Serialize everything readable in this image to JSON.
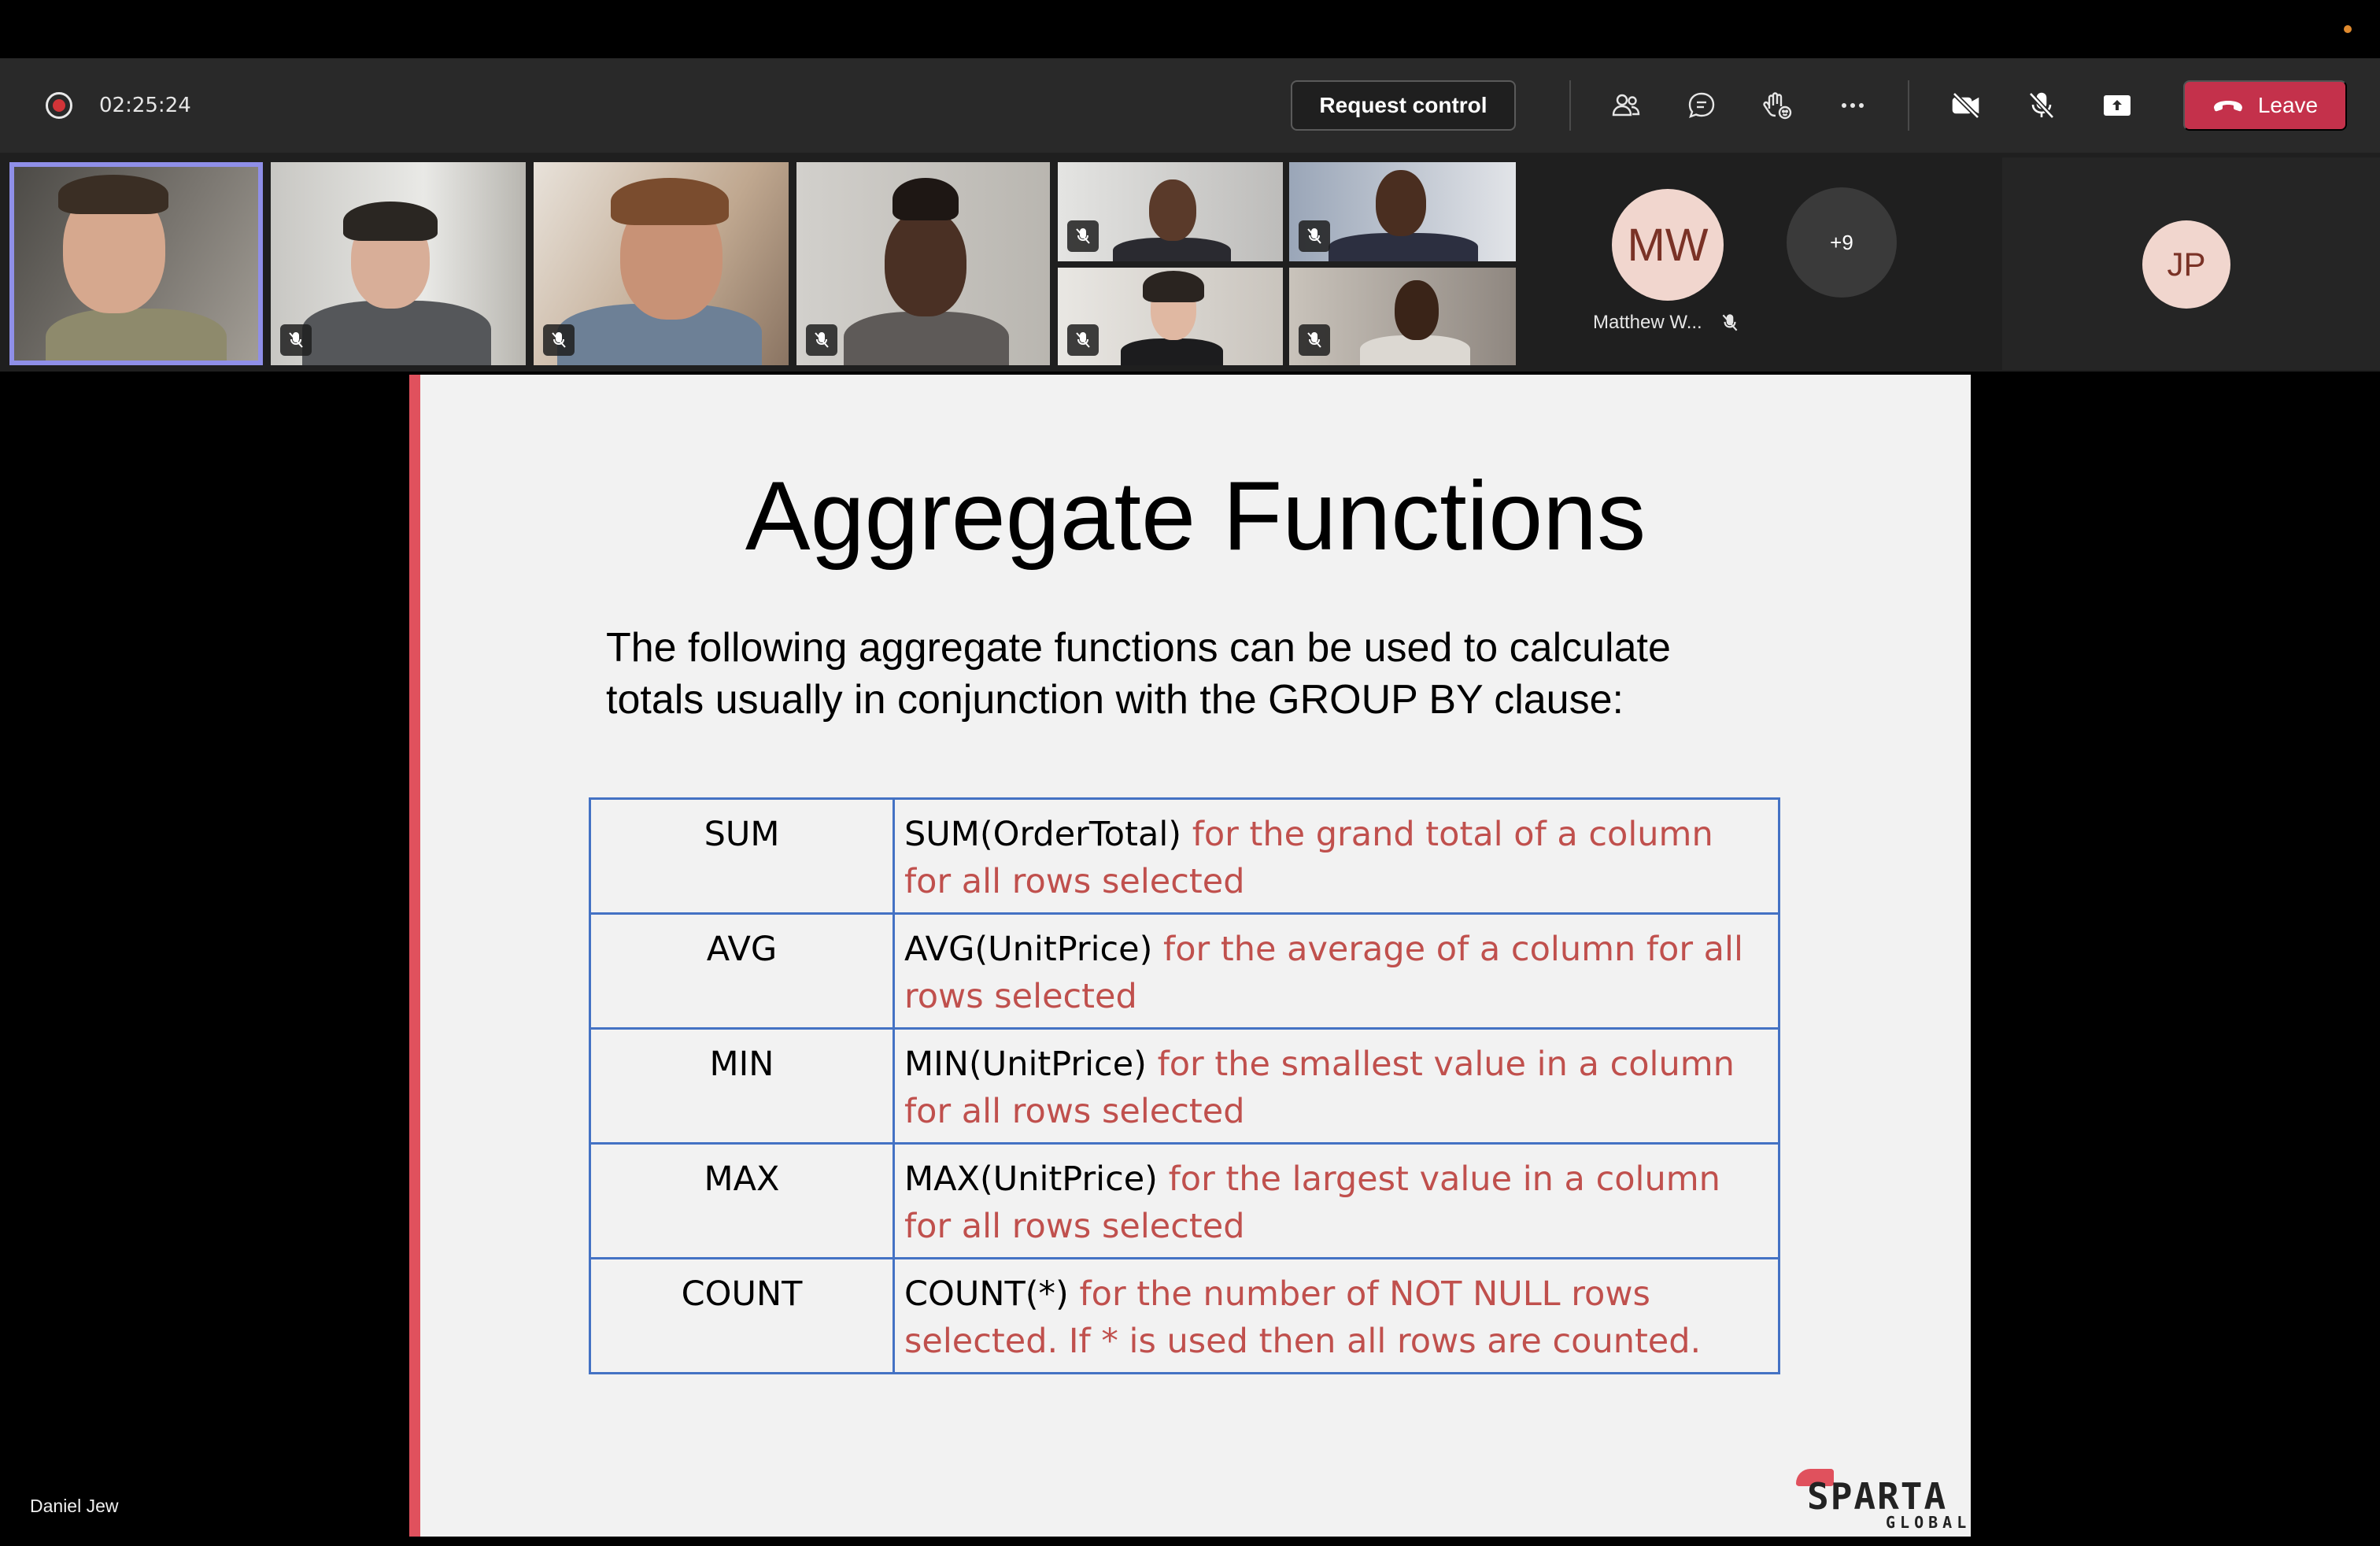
{
  "toolbar": {
    "timer": "02:25:24",
    "request_control_label": "Request control",
    "leave_label": "Leave",
    "icons": [
      "people-icon",
      "chat-icon",
      "reactions-icon",
      "more-icon",
      "camera-off-icon",
      "mic-off-icon",
      "share-screen-icon"
    ]
  },
  "participants": {
    "named": {
      "initials": "MW",
      "name": "Matthew W..."
    },
    "overflow_count": "+9",
    "side_panel": {
      "initials": "JP"
    }
  },
  "stage": {
    "presenter_name": "Daniel Jew"
  },
  "slide": {
    "title": "Aggregate Functions",
    "intro_line1": "The following aggregate functions can be used to calculate",
    "intro_line2": "totals usually in conjunction with the GROUP BY clause:",
    "rows": [
      {
        "name": "SUM",
        "example": "SUM(OrderTotal)",
        "description": " for the grand total of a column for all rows selected"
      },
      {
        "name": "AVG",
        "example": "AVG(UnitPrice)",
        "description": " for the average of a column for all rows selected"
      },
      {
        "name": "MIN",
        "example": "MIN(UnitPrice)",
        "description": " for the smallest value in a column for all rows selected"
      },
      {
        "name": "MAX",
        "example": "MAX(UnitPrice)",
        "description": " for the largest value in a column for all rows selected"
      },
      {
        "name": "COUNT",
        "example": "COUNT(*)",
        "description": " for the number of NOT NULL rows selected. If * is used then all rows are counted."
      }
    ],
    "logo_text": "SPARTA",
    "logo_subtext": "GLOBAL"
  },
  "colors": {
    "toolbar_bg": "#292929",
    "leave_red": "#c4314b",
    "slide_accent": "#e0515d",
    "table_border": "#4472c4",
    "description_red": "#c0504d",
    "avatar_bg": "#f1d6ce"
  }
}
